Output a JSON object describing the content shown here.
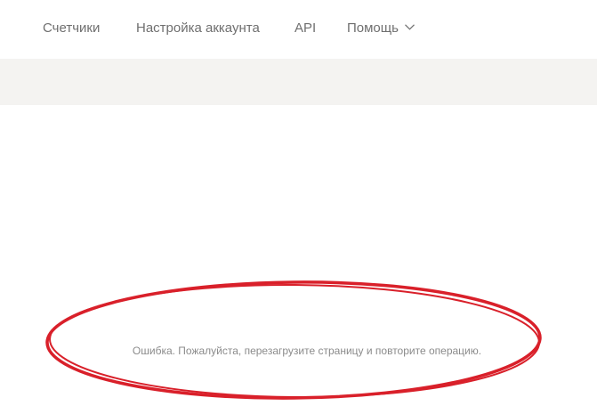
{
  "nav": {
    "items": [
      {
        "label": "Счетчики"
      },
      {
        "label": "Настройка аккаунта"
      },
      {
        "label": "API"
      },
      {
        "label": "Помощь",
        "icon": "chevron-down-icon"
      }
    ]
  },
  "main": {
    "error_message": "Ошибка. Пожалуйста, перезагрузите страницу и повторите операцию."
  },
  "colors": {
    "nav_text": "#6f6f6f",
    "subbar_bg": "#f4f3f1",
    "error_text": "#8b8b8b",
    "annotation": "#d9202a"
  }
}
